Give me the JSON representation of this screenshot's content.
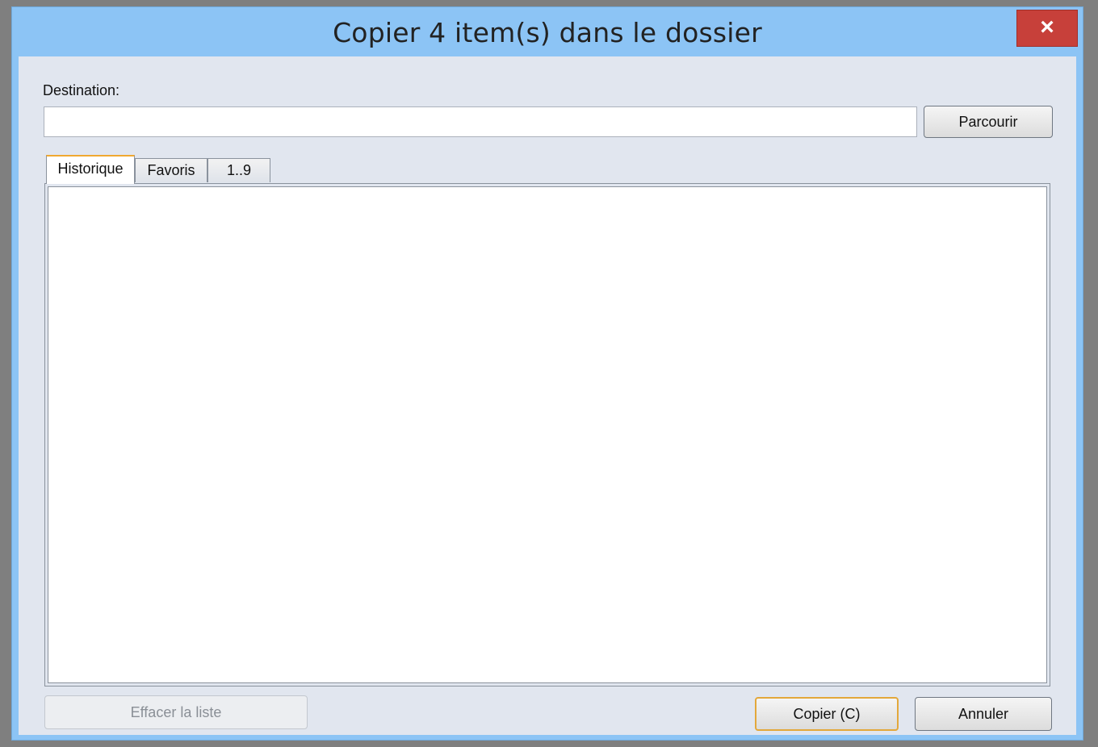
{
  "window": {
    "title": "Copier 4 item(s) dans le dossier",
    "close_label": "×",
    "accent_color": "#8cc4f5",
    "close_color": "#c7403a"
  },
  "destination": {
    "label": "Destination:",
    "value": "",
    "browse_label": "Parcourir"
  },
  "tabs": [
    {
      "label": "Historique",
      "active": true
    },
    {
      "label": "Favoris",
      "active": false
    },
    {
      "label": "1..9",
      "active": false
    }
  ],
  "list": {
    "items": []
  },
  "footer": {
    "clear_label": "Effacer la liste",
    "copy_label": "Copier (C)",
    "cancel_label": "Annuler"
  }
}
